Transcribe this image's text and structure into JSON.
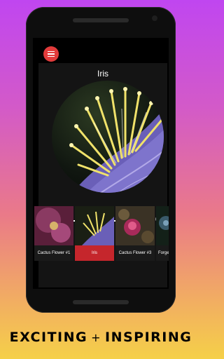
{
  "image": {
    "title": "Iris",
    "zoom_level": 0.0
  },
  "menu": {
    "icon": "hamburger-menu-icon"
  },
  "zoom": {
    "out_icon": "zoom-out-icon",
    "in_icon": "zoom-in-icon"
  },
  "gallery": {
    "items": [
      {
        "label": "Cactus Flower #1",
        "selected": false
      },
      {
        "label": "Iris",
        "selected": true
      },
      {
        "label": "Cactus Flower #3",
        "selected": false
      },
      {
        "label": "Forge",
        "selected": false
      }
    ]
  },
  "tagline": {
    "left": "EXCITING",
    "plus": "+",
    "right": "INSPIRING"
  },
  "colors": {
    "accent": "#c5262c",
    "menu": "#e23b3b",
    "thumb": "#e02a2a"
  }
}
